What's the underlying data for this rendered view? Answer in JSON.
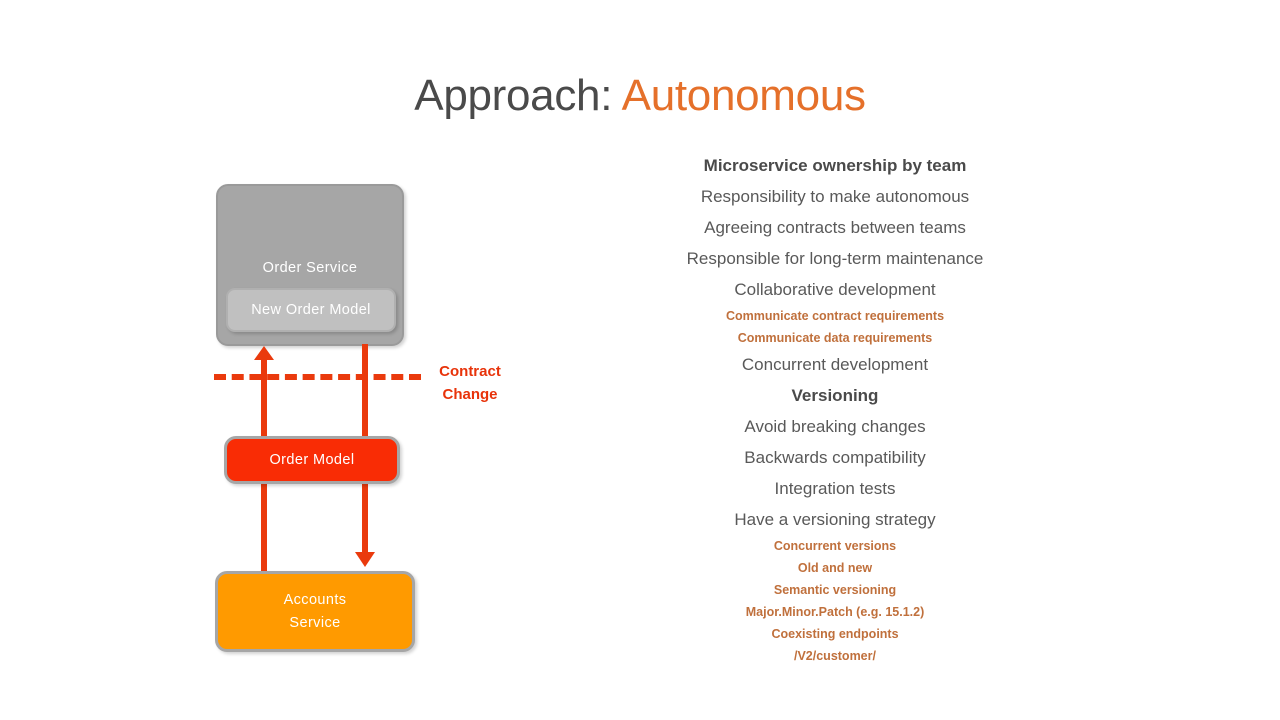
{
  "title": {
    "plain": "Approach: ",
    "accent": "Autonomous",
    "accent_color": "#e5702a",
    "plain_color": "#4a4a4a"
  },
  "diagram": {
    "order_service": "Order Service",
    "new_order_model": "New Order Model",
    "order_model": "Order Model",
    "accounts_service": "Accounts\nService",
    "accounts_service_line1": "Accounts",
    "accounts_service_line2": "Service",
    "contract_change_line1": "Contract",
    "contract_change_line2": "Change",
    "colors": {
      "order_service_fill": "#a6a6a6",
      "new_order_model_fill": "#c0c0c0",
      "order_model_fill": "#f92c05",
      "accounts_service_fill": "#ff9a00",
      "box_border": "#a6a6a6",
      "connector": "#ea3a0d",
      "contract_label": "#e8330a"
    }
  },
  "bullets": [
    {
      "level": 1,
      "text": "Microservice ownership by team"
    },
    {
      "level": 2,
      "text": "Responsibility to make autonomous"
    },
    {
      "level": 2,
      "text": "Agreeing contracts between teams"
    },
    {
      "level": 2,
      "text": "Responsible for long-term maintenance"
    },
    {
      "level": 2,
      "text": "Collaborative development"
    },
    {
      "level": 3,
      "text": "Communicate contract requirements"
    },
    {
      "level": 3,
      "text": "Communicate data requirements"
    },
    {
      "level": 2,
      "text": "Concurrent development"
    },
    {
      "level": 1,
      "text": "Versioning"
    },
    {
      "level": 2,
      "text": "Avoid breaking changes"
    },
    {
      "level": 2,
      "text": "Backwards compatibility"
    },
    {
      "level": 2,
      "text": "Integration tests"
    },
    {
      "level": 2,
      "text": "Have a versioning strategy"
    },
    {
      "level": 3,
      "text": "Concurrent versions"
    },
    {
      "level": 4,
      "text": "Old and new"
    },
    {
      "level": 3,
      "text": "Semantic versioning"
    },
    {
      "level": 4,
      "text": "Major.Minor.Patch (e.g. 15.1.2)"
    },
    {
      "level": 3,
      "text": "Coexisting endpoints"
    },
    {
      "level": 4,
      "text": "/V2/customer/"
    }
  ]
}
